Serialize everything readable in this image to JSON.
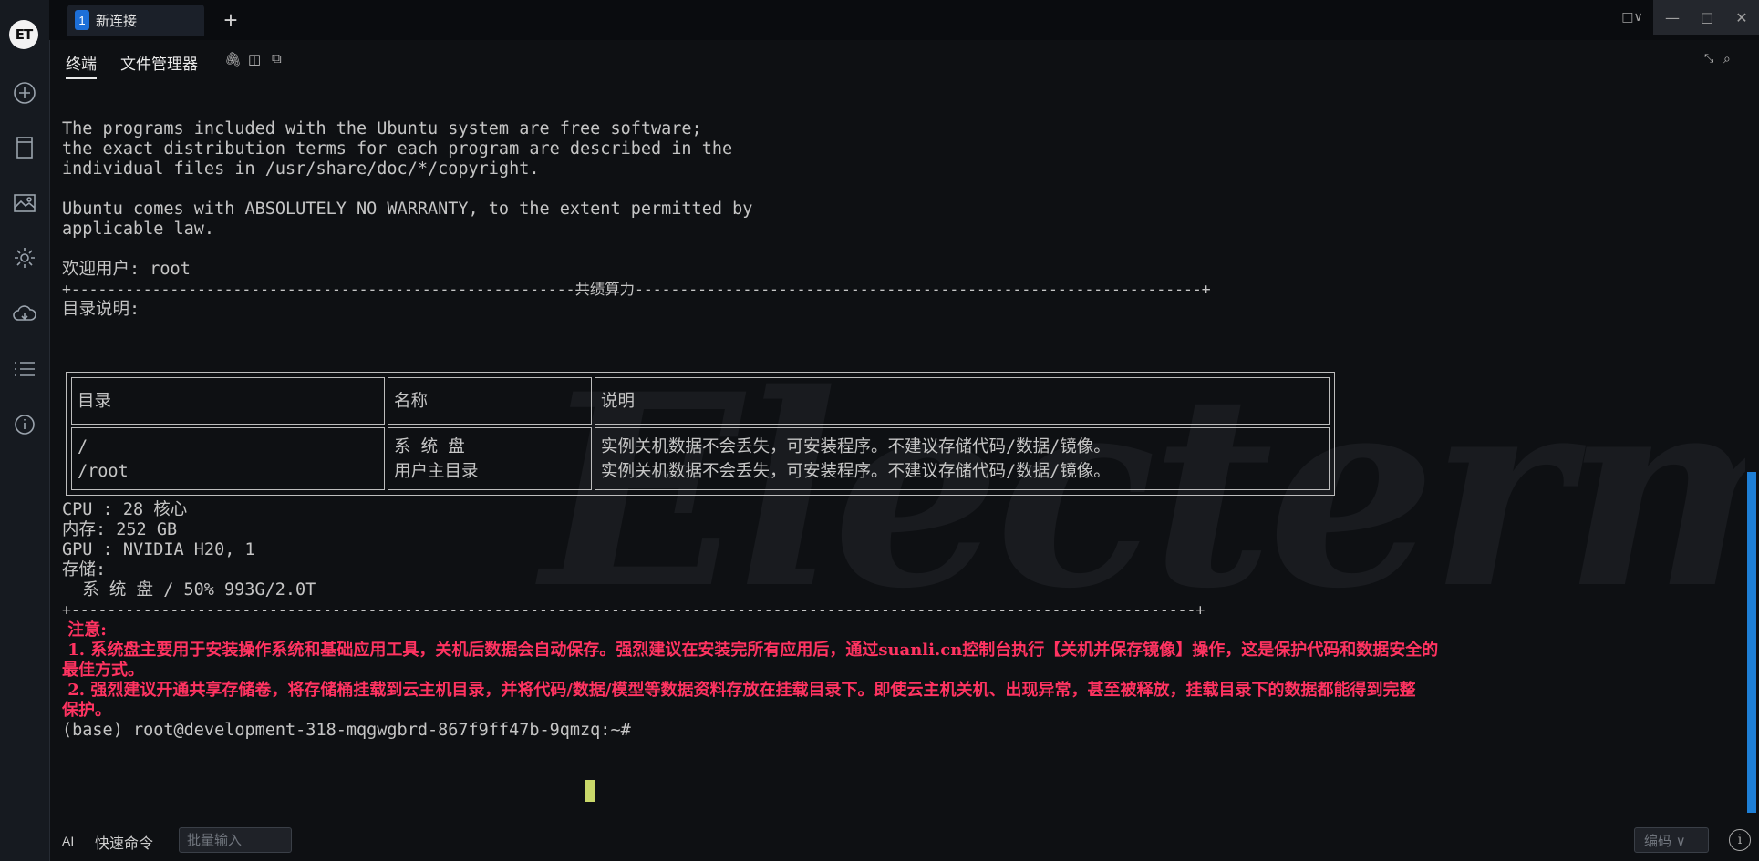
{
  "app": {
    "logo_text": "ET",
    "accent_color": "#1d6fd8"
  },
  "rail": {
    "items": [
      "add-icon",
      "bookmark-icon",
      "image-icon",
      "gear-icon",
      "cloud-icon",
      "list-icon",
      "info-icon"
    ]
  },
  "tabbar": {
    "tab_number": "1",
    "tab_title": "新连接",
    "add_label": "+"
  },
  "subbar": {
    "terminal_label": "终端",
    "files_label": "文件管理器"
  },
  "terminal": {
    "lines": [
      "The programs included with the Ubuntu system are free software;",
      "the exact distribution terms for each program are described in the",
      "individual files in /usr/share/doc/*/copyright.",
      "",
      "Ubuntu comes with ABSOLUTELY NO WARRANTY, to the extent permitted by",
      "applicable law.",
      "",
      "欢迎用户: root",
      "+--------------------------------------------------------共绩算力---------------------------------------------------------------+",
      "目录说明:"
    ],
    "table": {
      "headers": [
        "目录",
        "名称",
        "说明"
      ],
      "rows": [
        [
          "/",
          "系 统 盘",
          "实例关机数据不会丢失，可安装程序。不建议存储代码/数据/镜像。"
        ],
        [
          "/root",
          "用户主目录",
          "实例关机数据不会丢失，可安装程序。不建议存储代码/数据/镜像。"
        ]
      ]
    },
    "sysinfo": [
      "CPU : 28 核心",
      "内存: 252 GB",
      "GPU : NVIDIA H20, 1",
      "存储:",
      "  系 统 盘 / 50% 993G/2.0T",
      "+-----------------------------------------------------------------------------------------------------------------------------+"
    ],
    "notice_title": " 注意:",
    "notice_1a": " 1. 系统盘主要用于安装操作系统和基础应用工具，关机后数据会自动保存。强烈建议在安装完所有应用后，通过suanli.cn控制台执行【关机并保存镜像】操作，这是保护代码和数据安全的",
    "notice_1b": "最佳方式。",
    "notice_2a": " 2. 强烈建议开通共享存储卷，将存储桶挂载到云主机目录，并将代码/数据/模型等数据资料存放在挂载目录下。即使云主机关机、出现异常，甚至被释放，挂载目录下的数据都能得到完整",
    "notice_2b": "保护。",
    "prompt": "(base) root@development-318-mqgwgbrd-867f9ff47b-9qmzq:~# ",
    "notice_color": "#ff3361",
    "cursor_color": "#c9d86a"
  },
  "bottombar": {
    "ai_label": "AI",
    "quick_cmd_label": "快速命令",
    "batch_placeholder": "批量输入",
    "encoding_label": "编码 ∨",
    "info_label": "i"
  }
}
